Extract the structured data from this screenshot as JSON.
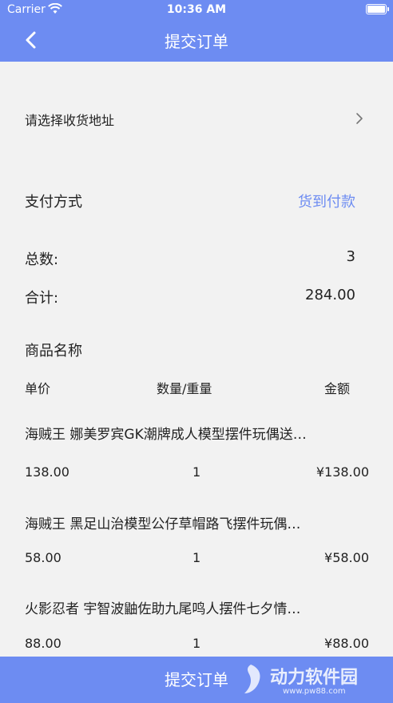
{
  "status_bar": {
    "carrier": "Carrier",
    "time": "10:36 AM"
  },
  "header": {
    "title": "提交订单"
  },
  "address": {
    "label": "请选择收货地址"
  },
  "payment": {
    "label": "支付方式",
    "value": "货到付款"
  },
  "summary": {
    "total_count_label": "总数:",
    "total_count": "3",
    "sum_label": "合计:",
    "sum_value": "284.00"
  },
  "goods": {
    "header": "商品名称",
    "columns": {
      "price": "单价",
      "qty": "数量/重量",
      "amount": "金额"
    },
    "items": [
      {
        "name": "海贼王 娜美罗宾GK潮牌成人模型摆件玩偶送…",
        "price": "138.00",
        "qty": "1",
        "amount": "¥138.00"
      },
      {
        "name": "海贼王 黑足山治模型公仔草帽路飞摆件玩偶…",
        "price": "58.00",
        "qty": "1",
        "amount": "¥58.00"
      },
      {
        "name": "火影忍者 宇智波鼬佐助九尾鸣人摆件七夕情…",
        "price": "88.00",
        "qty": "1",
        "amount": "¥88.00"
      }
    ]
  },
  "footer": {
    "submit_label": "提交订单"
  },
  "watermark": {
    "text": "动力软件园",
    "url": "www.pw88.com"
  }
}
